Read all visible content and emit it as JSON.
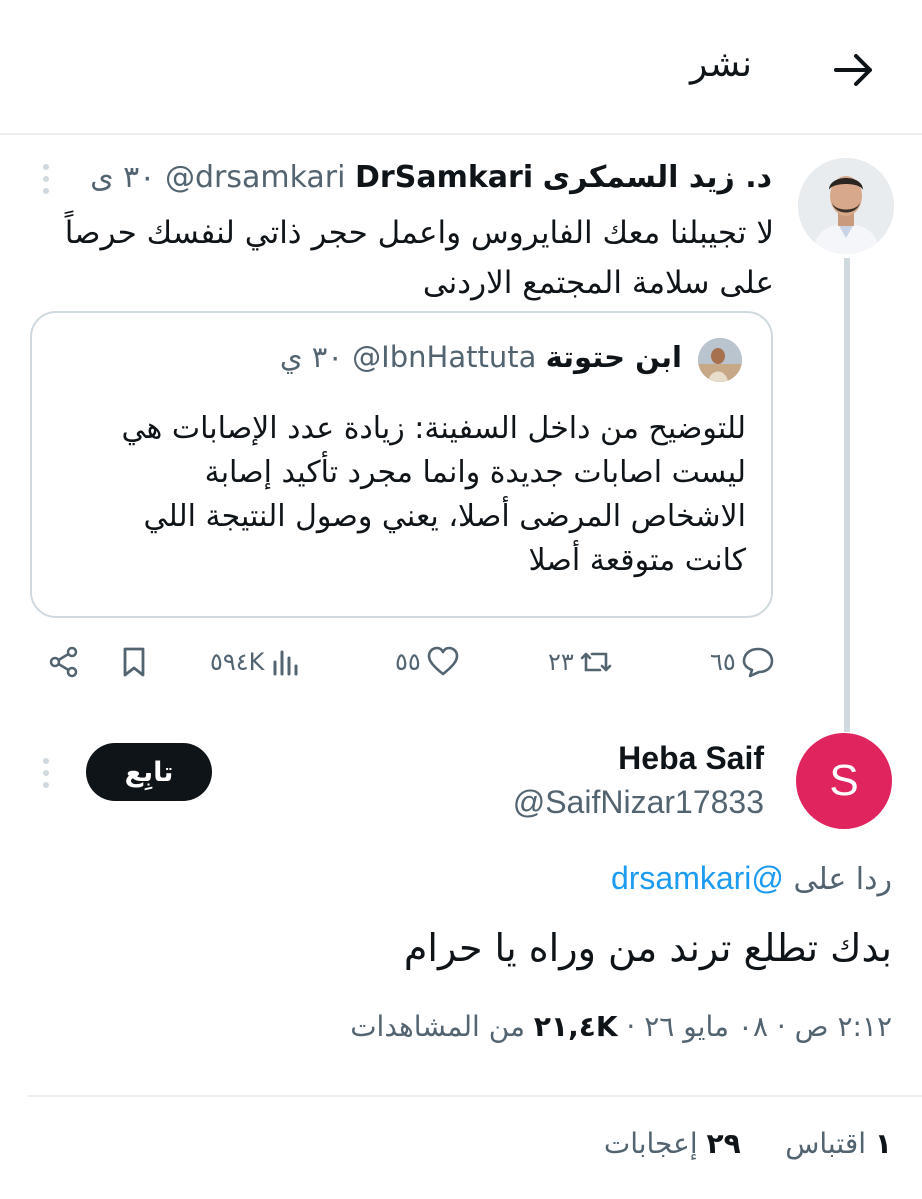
{
  "header": {
    "title": "نشر",
    "back_icon": "arrow-right-icon"
  },
  "parent_tweet": {
    "author_name_ar": "د. زيد السمكرى",
    "author_name_en": "DrSamkari",
    "handle": "@drsamkari",
    "time": "٣٠ ى",
    "text": "لا تجيبلنا معك الفايروس واعمل حجر ذاتي لنفسك حرصاً على سلامة المجتمع الاردنى",
    "quoted": {
      "author_name": "ابن حتوتة",
      "handle": "@IbnHattuta",
      "time": "٣٠ ي",
      "text": "للتوضيح من داخل السفينة: زيادة عدد الإصابات هي ليست اصابات جديدة وانما مجرد تأكيد إصابة الاشخاص المرضى أصلا، يعني وصول النتيجة اللي كانت متوقعة أصلا"
    },
    "actions": {
      "replies": "٦٥",
      "retweets": "٢٣",
      "likes": "٥٥",
      "views": "٥٩٤K"
    }
  },
  "reply": {
    "author_name": "Heba Saif",
    "handle": "@SaifNizar17833",
    "avatar_letter": "S",
    "avatar_color": "#e0245e",
    "follow_label": "تابِع",
    "replying_prefix": "ردا على",
    "replying_to": "@drsamkari",
    "text": "بدك تطلع ترند من وراه يا حرام",
    "timestamp": "٢:١٢ ص · ٠٨ مايو ٢٦ · ",
    "views_count": "٢١,٤K",
    "views_label": " من المشاهدات"
  },
  "stats": {
    "quotes_count": "١",
    "quotes_label": " اقتباس",
    "likes_count": "٢٩",
    "likes_label": " إعجابات"
  }
}
